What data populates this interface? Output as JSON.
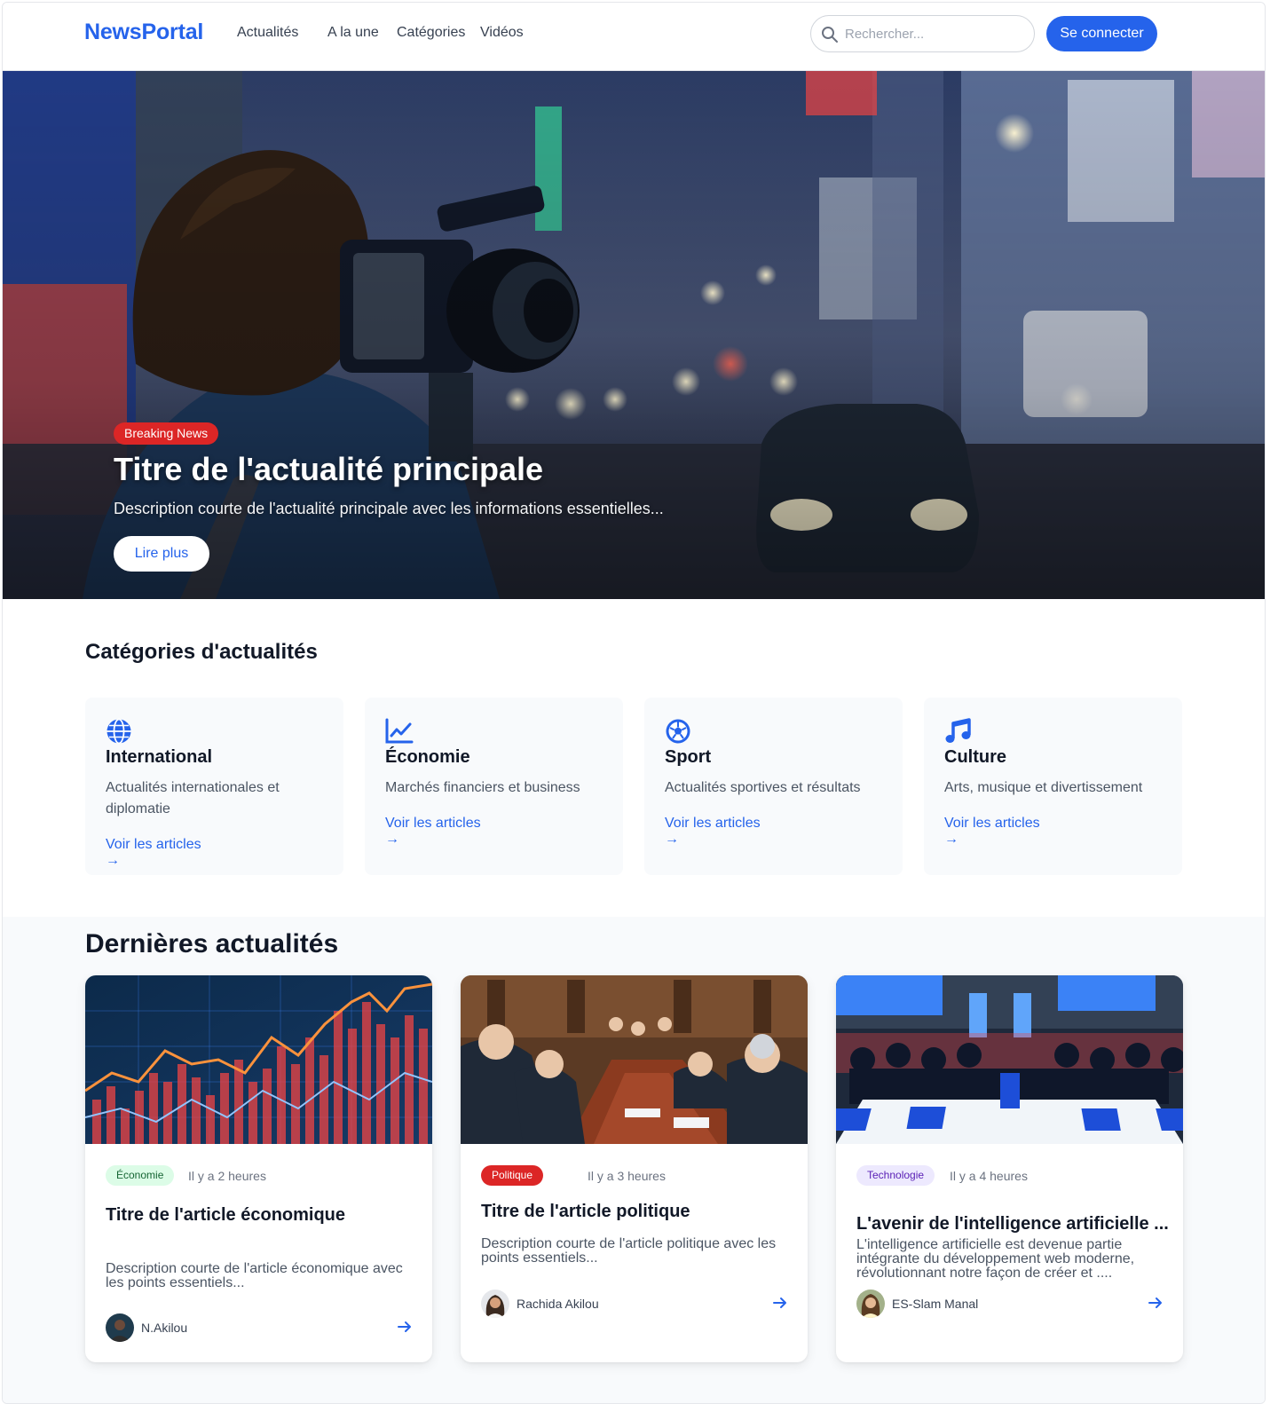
{
  "brand": "NewsPortal",
  "nav": {
    "links": [
      "Actualités",
      "A la une",
      "Catégories",
      "Vidéos"
    ],
    "search_placeholder": "Rechercher...",
    "login_label": "Se connecter"
  },
  "hero": {
    "badge": "Breaking News",
    "title": "Titre de l'actualité principale",
    "description": "Description courte de l'actualité principale avec les informations essentielles...",
    "button": "Lire plus"
  },
  "categories": {
    "title": "Catégories d'actualités",
    "link_label": "Voir les articles",
    "link_arrow": "→",
    "items": [
      {
        "name": "International",
        "description": "Actualités internationales et diplomatie",
        "icon": "globe-icon"
      },
      {
        "name": "Économie",
        "description": "Marchés financiers et business",
        "icon": "chart-line-icon"
      },
      {
        "name": "Sport",
        "description": "Actualités sportives et résultats",
        "icon": "football-icon"
      },
      {
        "name": "Culture",
        "description": "Arts, musique et divertissement",
        "icon": "music-icon"
      }
    ]
  },
  "latest": {
    "title": "Dernières actualités",
    "articles": [
      {
        "tag": "Économie",
        "time": "Il y a 2 heures",
        "title": "Titre de l'article économique",
        "description": "Description courte de l'article économique avec les points essentiels...",
        "author": "N.Akilou",
        "tag_bg": "#dcfce7",
        "tag_color": "#166534"
      },
      {
        "tag": "Politique",
        "time": "Il y a 3 heures",
        "title": "Titre de l'article politique",
        "description": "Description courte de l'article politique avec les points essentiels...",
        "author": "Rachida Akilou",
        "tag_bg": "#dc2626",
        "tag_color": "#ffffff"
      },
      {
        "tag": "Technologie",
        "time": "Il y a 4 heures",
        "title": "L'avenir de l'intelligence artificielle ...",
        "description": "L'intelligence artificielle est devenue partie intégrante du développement web moderne, révolutionnant notre façon de créer et ....",
        "author": "ES-Slam Manal",
        "tag_bg": "#ede9fe",
        "tag_color": "#5b21b6"
      }
    ]
  },
  "colors": {
    "accent": "#2563eb",
    "breaking": "#dc2626"
  }
}
